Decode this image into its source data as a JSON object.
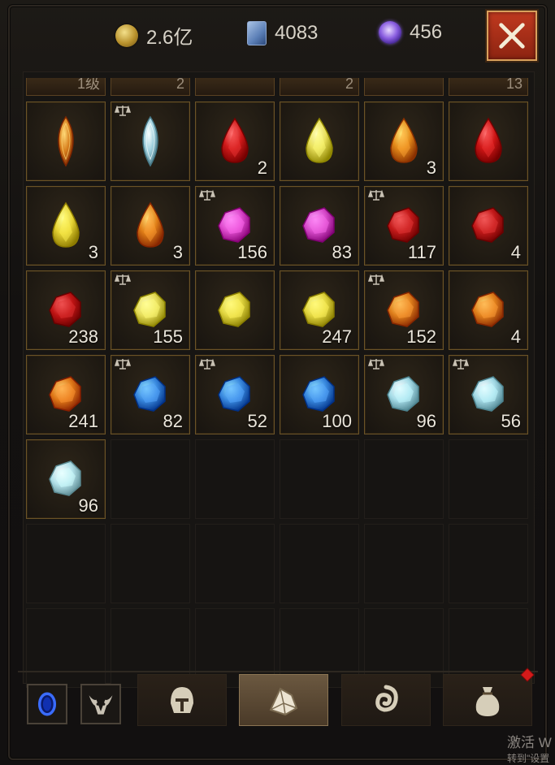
{
  "currency": {
    "gold": "2.6亿",
    "tickets": "4083",
    "orbs": "456"
  },
  "top_strip": [
    "1级",
    "2",
    "",
    "2",
    "",
    "13"
  ],
  "inventory": [
    {
      "gem": "marquise-amber",
      "color": "#d8801e",
      "count": "",
      "tradable": false
    },
    {
      "gem": "marquise-diamond",
      "color": "#9fd0de",
      "count": "",
      "tradable": true
    },
    {
      "gem": "teardrop-ruby",
      "color": "#d01a1a",
      "count": "2",
      "tradable": false
    },
    {
      "gem": "teardrop-topaz",
      "color": "#e8df5a",
      "count": "",
      "tradable": false
    },
    {
      "gem": "teardrop-amber",
      "color": "#e48a1a",
      "count": "3",
      "tradable": false
    },
    {
      "gem": "teardrop-ruby",
      "color": "#cf1616",
      "count": "",
      "tradable": false
    },
    {
      "gem": "teardrop-topaz",
      "color": "#e6d435",
      "count": "3",
      "tradable": false
    },
    {
      "gem": "teardrop-amber",
      "color": "#e07f18",
      "count": "3",
      "tradable": false
    },
    {
      "gem": "rough-amethyst",
      "color": "#e04ccf",
      "count": "156",
      "tradable": true
    },
    {
      "gem": "rough-amethyst",
      "color": "#d94ccc",
      "count": "83",
      "tradable": false
    },
    {
      "gem": "rough-ruby",
      "color": "#c41a1a",
      "count": "117",
      "tradable": true
    },
    {
      "gem": "rough-ruby",
      "color": "#c41a1a",
      "count": "4",
      "tradable": false
    },
    {
      "gem": "rough-ruby",
      "color": "#c01414",
      "count": "238",
      "tradable": false
    },
    {
      "gem": "rough-topaz",
      "color": "#e6dd5a",
      "count": "155",
      "tradable": true
    },
    {
      "gem": "rough-topaz",
      "color": "#e2d640",
      "count": "",
      "tradable": false
    },
    {
      "gem": "rough-topaz",
      "color": "#e2d640",
      "count": "247",
      "tradable": false
    },
    {
      "gem": "rough-amber",
      "color": "#e0801c",
      "count": "152",
      "tradable": true
    },
    {
      "gem": "rough-amber",
      "color": "#e0801c",
      "count": "4",
      "tradable": false
    },
    {
      "gem": "rough-amber",
      "color": "#e07818",
      "count": "241",
      "tradable": false
    },
    {
      "gem": "rough-sapphire",
      "color": "#3a8ae0",
      "count": "82",
      "tradable": true
    },
    {
      "gem": "rough-sapphire",
      "color": "#3a8ae0",
      "count": "52",
      "tradable": true
    },
    {
      "gem": "rough-sapphire",
      "color": "#3a8ae0",
      "count": "100",
      "tradable": false
    },
    {
      "gem": "rough-diamond",
      "color": "#a6dce8",
      "count": "96",
      "tradable": true
    },
    {
      "gem": "rough-diamond",
      "color": "#a6dce8",
      "count": "56",
      "tradable": true
    },
    {
      "gem": "rough-diamond",
      "color": "#b4e2ea",
      "count": "96",
      "tradable": false
    }
  ],
  "bottom_tabs": [
    {
      "name": "tab-helmet",
      "icon": "helmet-icon",
      "active": false
    },
    {
      "name": "tab-gems",
      "icon": "gem-bag-icon",
      "active": true
    },
    {
      "name": "tab-swirl",
      "icon": "swirl-icon",
      "active": false
    },
    {
      "name": "tab-sack",
      "icon": "sack-icon",
      "active": false
    }
  ],
  "watermark": {
    "line1": "激活 W",
    "line2": "转到\"设置"
  }
}
